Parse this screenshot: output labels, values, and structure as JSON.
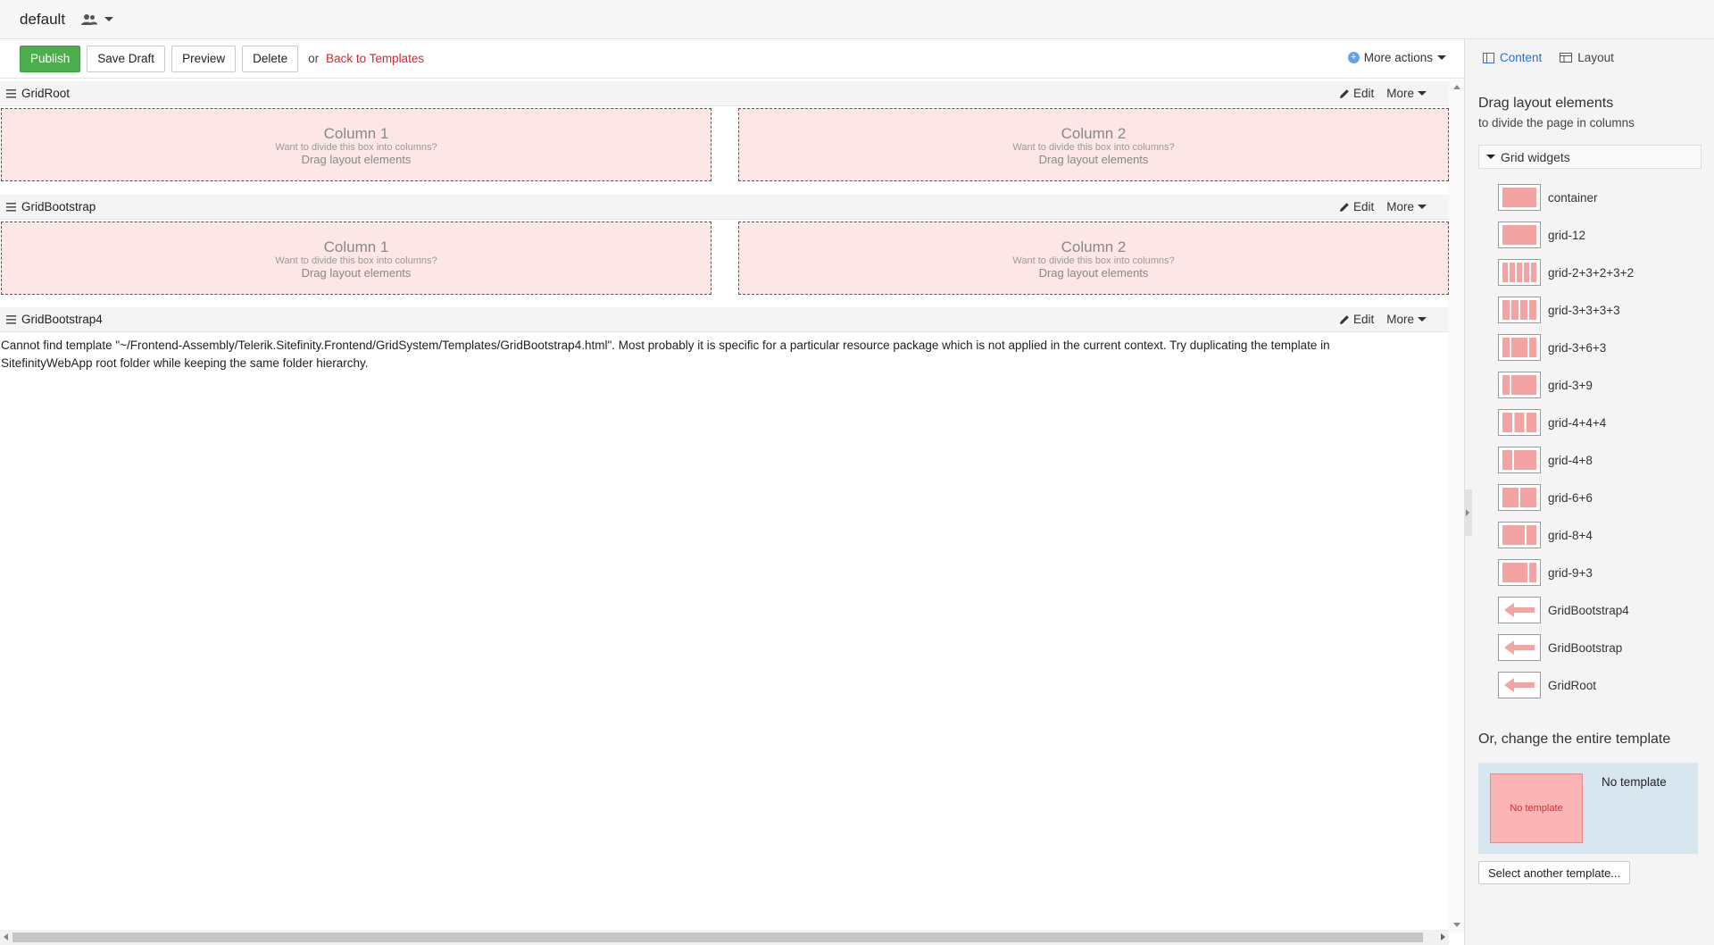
{
  "topbar": {
    "page_name": "default",
    "icons": {
      "users": "users-icon",
      "caret": "chevron-down-icon"
    }
  },
  "toolbar": {
    "publish_label": "Publish",
    "save_draft_label": "Save Draft",
    "preview_label": "Preview",
    "delete_label": "Delete",
    "or_text": "or",
    "back_label": "Back to Templates",
    "more_actions_label": "More actions"
  },
  "canvas": {
    "widgets": [
      {
        "title": "GridRoot",
        "edit_label": "Edit",
        "more_label": "More",
        "columns": [
          {
            "title": "Column 1",
            "hint": "Want to divide this box into columns?",
            "drag": "Drag layout elements"
          },
          {
            "title": "Column 2",
            "hint": "Want to divide this box into columns?",
            "drag": "Drag layout elements"
          }
        ]
      },
      {
        "title": "GridBootstrap",
        "edit_label": "Edit",
        "more_label": "More",
        "columns": [
          {
            "title": "Column 1",
            "hint": "Want to divide this box into columns?",
            "drag": "Drag layout elements"
          },
          {
            "title": "Column 2",
            "hint": "Want to divide this box into columns?",
            "drag": "Drag layout elements"
          }
        ]
      },
      {
        "title": "GridBootstrap4",
        "edit_label": "Edit",
        "more_label": "More",
        "error": "Cannot find template \"~/Frontend-Assembly/Telerik.Sitefinity.Frontend/GridSystem/Templates/GridBootstrap4.html\". Most probably it is specific for a particular resource package which is not applied in the current context. Try duplicating the template in SitefinityWebApp root folder while keeping the same folder hierarchy."
      }
    ]
  },
  "side_panel": {
    "tabs": [
      {
        "label": "Content",
        "icon": "content-panel-icon",
        "active": true
      },
      {
        "label": "Layout",
        "icon": "layout-panel-icon",
        "active": false
      }
    ],
    "heading": "Drag layout elements",
    "subheading": "to divide the page in columns",
    "group_label": "Grid widgets",
    "widgets": [
      {
        "label": "container",
        "icon": "grid-full-icon"
      },
      {
        "label": "grid-12",
        "icon": "grid-full-icon"
      },
      {
        "label": "grid-2+3+2+3+2",
        "icon": "grid-5-col-icon"
      },
      {
        "label": "grid-3+3+3+3",
        "icon": "grid-4-col-icon"
      },
      {
        "label": "grid-3+6+3",
        "icon": "grid-3-6-3-icon"
      },
      {
        "label": "grid-3+9",
        "icon": "grid-3-9-icon"
      },
      {
        "label": "grid-4+4+4",
        "icon": "grid-3-col-icon"
      },
      {
        "label": "grid-4+8",
        "icon": "grid-4-8-icon"
      },
      {
        "label": "grid-6+6",
        "icon": "grid-2-col-icon"
      },
      {
        "label": "grid-8+4",
        "icon": "grid-8-4-icon"
      },
      {
        "label": "grid-9+3",
        "icon": "grid-9-3-icon"
      },
      {
        "label": "GridBootstrap4",
        "icon": "arrow-left-icon"
      },
      {
        "label": "GridBootstrap",
        "icon": "arrow-left-icon"
      },
      {
        "label": "GridRoot",
        "icon": "arrow-left-icon"
      }
    ],
    "change_heading": "Or, change the entire template",
    "template_thumb_label": "No template",
    "template_name": "No template",
    "select_button_label": "Select another template..."
  },
  "colors": {
    "publish": "#4cae4c",
    "link": "#d9262c",
    "accent": "#2a6fc9",
    "column_fill": "#fde6e6",
    "widget_icon": "#f4a3a3"
  }
}
